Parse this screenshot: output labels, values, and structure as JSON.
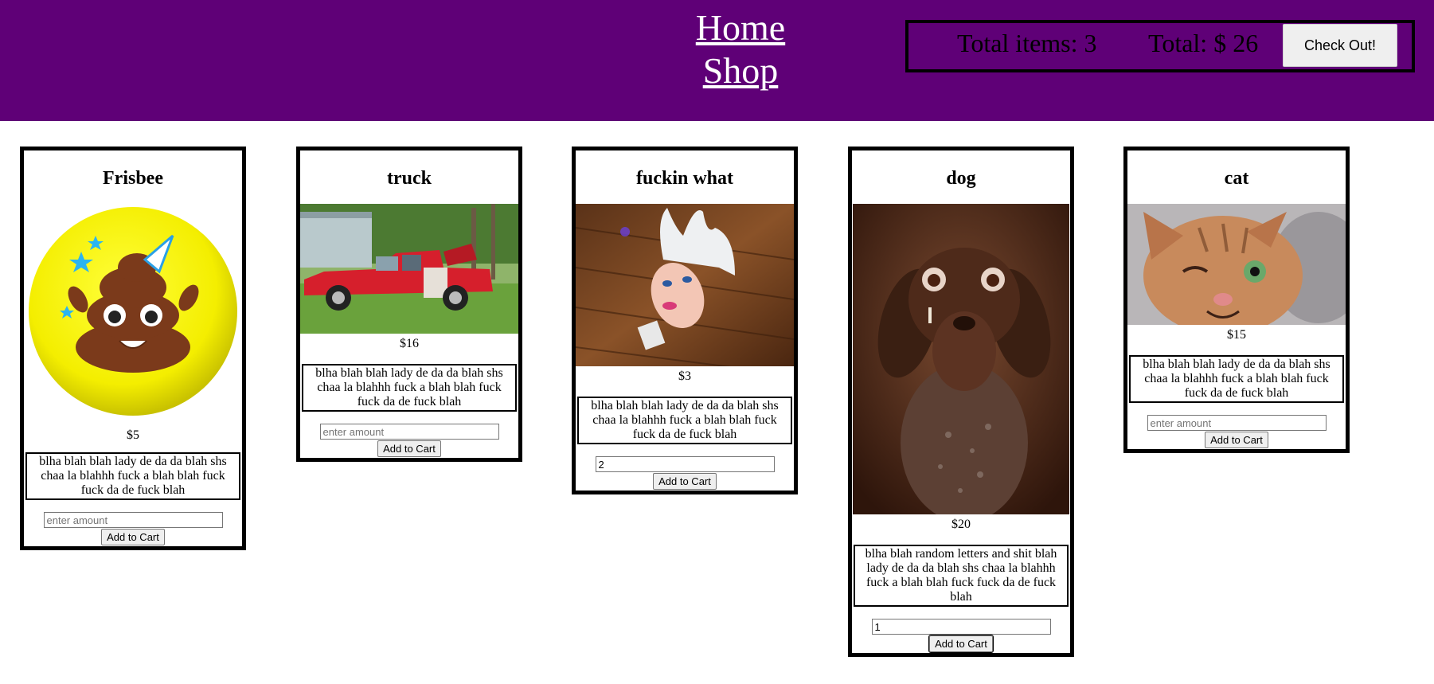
{
  "nav": {
    "home": "Home",
    "shop": "Shop"
  },
  "cart": {
    "items_text": "Total items: 3",
    "total_text": "Total: $ 26",
    "checkout_label": "Check Out!"
  },
  "products": [
    {
      "name": "Frisbee",
      "price": "$5",
      "image": "frisbee-image",
      "description": "blha blah blah lady de da da blah shs chaa la blahhh fuck a blah blah fuck fuck da de fuck blah",
      "amount": "",
      "placeholder": "enter amount",
      "button": "Add to Cart"
    },
    {
      "name": "truck",
      "price": "$16",
      "image": "truck-image",
      "description": "blha blah blah lady de da da blah shs chaa la blahhh fuck a blah blah fuck fuck da de fuck blah",
      "amount": "",
      "placeholder": "enter amount",
      "button": "Add to Cart"
    },
    {
      "name": "fuckin what",
      "price": "$3",
      "image": "doll-head-usb-image",
      "description": "blha blah blah lady de da da blah shs chaa la blahhh fuck a blah blah fuck fuck da de fuck blah",
      "amount": "2",
      "placeholder": "enter amount",
      "button": "Add to Cart"
    },
    {
      "name": "dog",
      "price": "$20",
      "image": "dog-image",
      "description": "blha blah random letters and shit blah lady de da da blah shs chaa la blahhh fuck a blah blah fuck fuck da de fuck blah",
      "amount": "1",
      "placeholder": "enter amount",
      "button": "Add to Cart"
    },
    {
      "name": "cat",
      "price": "$15",
      "image": "cat-image",
      "description": "blha blah blah lady de da da blah shs chaa la blahhh fuck a blah blah fuck fuck da de fuck blah",
      "amount": "",
      "placeholder": "enter amount",
      "button": "Add to Cart"
    }
  ],
  "colors": {
    "header": "#5f0077",
    "link": "#ffffff"
  }
}
